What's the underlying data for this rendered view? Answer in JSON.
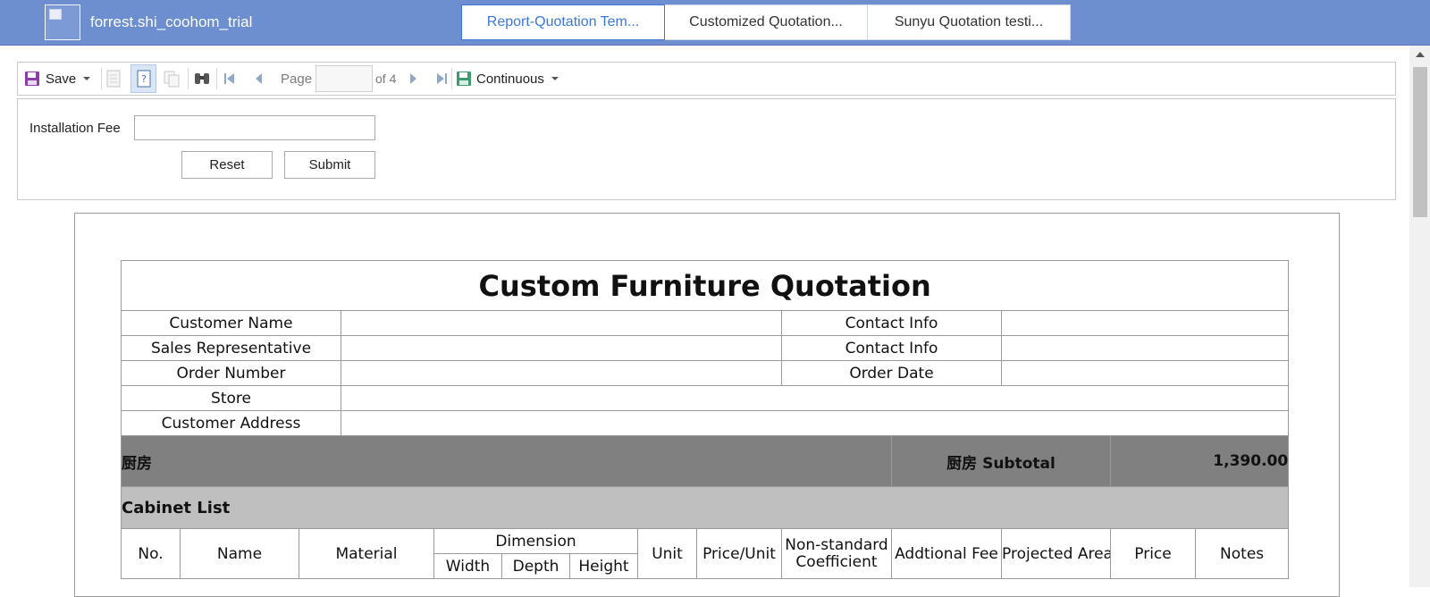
{
  "header": {
    "brand": "forrest.shi_coohom_trial",
    "tabs": [
      {
        "label": "Report-Quotation Tem...",
        "active": true
      },
      {
        "label": "Customized Quotation...",
        "active": false
      },
      {
        "label": "Sunyu Quotation testi...",
        "active": false
      }
    ]
  },
  "toolbar": {
    "save_label": "Save",
    "page_label": "Page",
    "page_value": "",
    "of_label": "of 4",
    "view_mode": "Continuous"
  },
  "params": {
    "installation_fee_label": "Installation Fee",
    "installation_fee_value": "",
    "reset_label": "Reset",
    "submit_label": "Submit"
  },
  "report": {
    "title": "Custom Furniture Quotation",
    "info_rows": [
      {
        "label": "Customer Name",
        "value": "",
        "label2": "Contact Info",
        "value2": ""
      },
      {
        "label": "Sales Representative",
        "value": "",
        "label2": "Contact Info",
        "value2": ""
      },
      {
        "label": "Order Number",
        "value": "",
        "label2": "Order Date",
        "value2": ""
      }
    ],
    "store_label": "Store",
    "store_value": "",
    "address_label": "Customer Address",
    "address_value": "",
    "section": {
      "name": "厨房",
      "subtotal_label": "厨房 Subtotal",
      "subtotal_value": "1,390.00"
    },
    "subsection": "Cabinet List",
    "columns": {
      "no": "No.",
      "name": "Name",
      "material": "Material",
      "dimension": "Dimension",
      "width": "Width",
      "depth": "Depth",
      "height": "Height",
      "unit": "Unit",
      "price_unit": "Price/Unit",
      "nonstandard": "Non-standard Coefficient",
      "additional_fee": "Addtional Fee",
      "projected_area": "Projected Area",
      "price": "Price",
      "notes": "Notes"
    }
  },
  "colors": {
    "header_bg": "#6d8fcf",
    "active_tab": "#3b78d8",
    "section_bg": "#808080",
    "subsection_bg": "#bfbfbf"
  },
  "icons": [
    "save-icon",
    "document-icon",
    "help-doc-icon",
    "copy-icon",
    "binoculars-icon",
    "first-page-icon",
    "prev-page-icon",
    "next-page-icon",
    "last-page-icon",
    "view-mode-icon"
  ]
}
